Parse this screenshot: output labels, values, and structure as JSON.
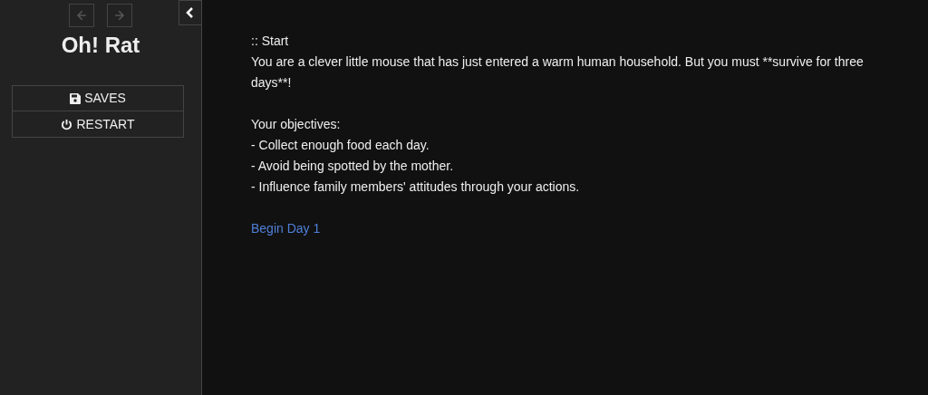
{
  "sidebar": {
    "back_disabled": true,
    "forward_disabled": true,
    "title": "Oh! Rat",
    "menu": [
      {
        "kind": "saves",
        "label": "SAVES"
      },
      {
        "kind": "restart",
        "label": "RESTART"
      }
    ]
  },
  "passage": {
    "title": ":: Start",
    "intro": "You are a clever little mouse that has just entered a warm human household. But you must **survive for three days**!",
    "objectives_heading": "Your objectives:",
    "objectives": [
      "- Collect enough food each day.",
      "- Avoid being spotted by the mother.",
      "- Influence family members' attitudes through your actions."
    ],
    "link": "Begin Day 1"
  }
}
